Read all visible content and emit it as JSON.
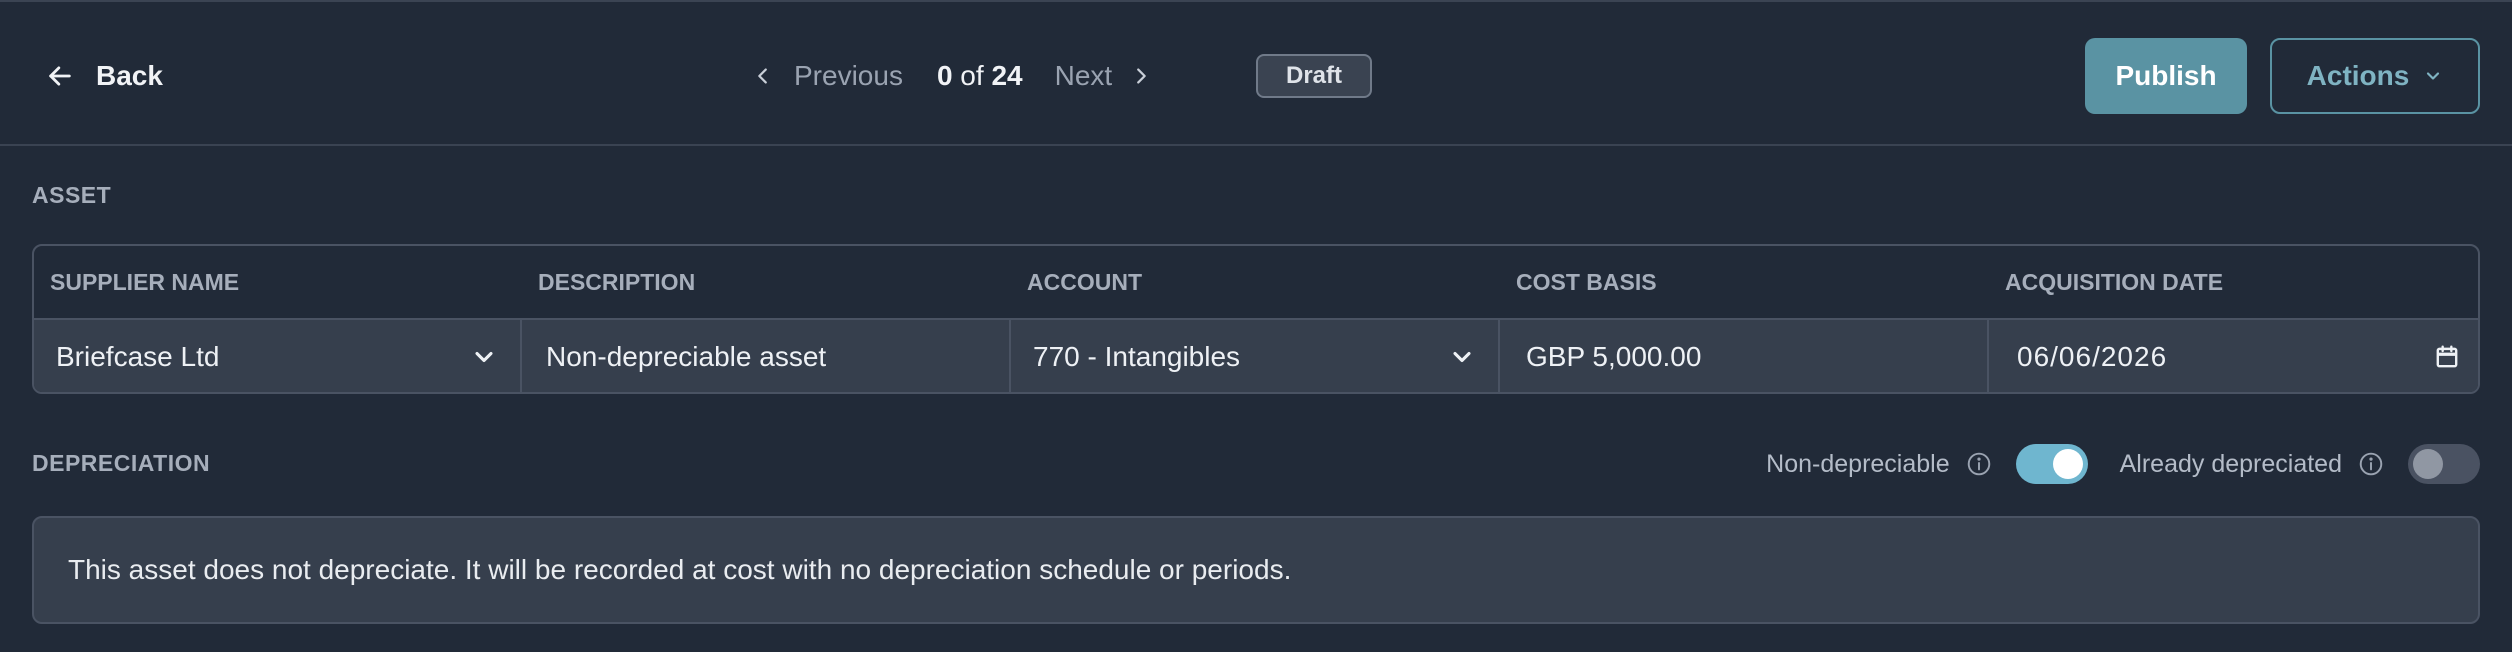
{
  "header": {
    "back_label": "Back",
    "previous_label": "Previous",
    "position": {
      "current": "0",
      "of": "of",
      "total": "24"
    },
    "next_label": "Next",
    "status_badge": "Draft",
    "publish_label": "Publish",
    "actions_label": "Actions"
  },
  "asset": {
    "section_title": "ASSET",
    "columns": [
      "SUPPLIER NAME",
      "DESCRIPTION",
      "ACCOUNT",
      "COST BASIS",
      "ACQUISITION DATE"
    ],
    "supplier_name": "Briefcase Ltd",
    "description": "Non-depreciable asset",
    "account": "770 - Intangibles",
    "cost_basis": "GBP 5,000.00",
    "acquisition_date": "06/06/2026"
  },
  "depreciation": {
    "section_title": "DEPRECIATION",
    "non_depreciable_label": "Non-depreciable",
    "non_depreciable_on": true,
    "already_depreciated_label": "Already depreciated",
    "already_depreciated_on": false,
    "note": "This asset does not depreciate. It will be recorded at cost with no depreciation schedule or periods."
  },
  "colors": {
    "background": "#212a38",
    "field_background": "#363f4d",
    "accent": "#5a93a3",
    "toggle_on": "#6fb6cf"
  },
  "icons": [
    "arrow-left-icon",
    "chevron-left-icon",
    "chevron-right-icon",
    "chevron-down-icon",
    "calendar-icon",
    "info-icon"
  ]
}
